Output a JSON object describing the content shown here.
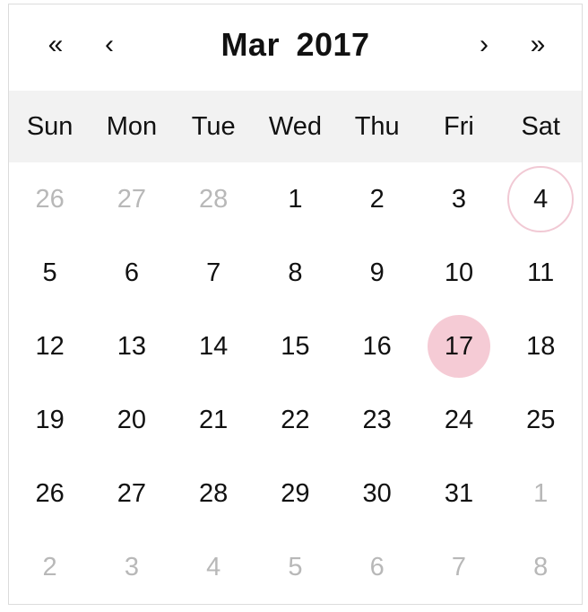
{
  "header": {
    "prev_year_label": "«",
    "prev_month_label": "‹",
    "title": "Mar 2017",
    "next_month_label": "›",
    "next_year_label": "»"
  },
  "weekdays": [
    "Sun",
    "Mon",
    "Tue",
    "Wed",
    "Thu",
    "Fri",
    "Sat"
  ],
  "days": [
    {
      "label": "26",
      "state": "other"
    },
    {
      "label": "27",
      "state": "other"
    },
    {
      "label": "28",
      "state": "other"
    },
    {
      "label": "1",
      "state": "current"
    },
    {
      "label": "2",
      "state": "current"
    },
    {
      "label": "3",
      "state": "current"
    },
    {
      "label": "4",
      "state": "today"
    },
    {
      "label": "5",
      "state": "current"
    },
    {
      "label": "6",
      "state": "current"
    },
    {
      "label": "7",
      "state": "current"
    },
    {
      "label": "8",
      "state": "current"
    },
    {
      "label": "9",
      "state": "current"
    },
    {
      "label": "10",
      "state": "current"
    },
    {
      "label": "11",
      "state": "current"
    },
    {
      "label": "12",
      "state": "current"
    },
    {
      "label": "13",
      "state": "current"
    },
    {
      "label": "14",
      "state": "current"
    },
    {
      "label": "15",
      "state": "current"
    },
    {
      "label": "16",
      "state": "current"
    },
    {
      "label": "17",
      "state": "selected"
    },
    {
      "label": "18",
      "state": "current"
    },
    {
      "label": "19",
      "state": "current"
    },
    {
      "label": "20",
      "state": "current"
    },
    {
      "label": "21",
      "state": "current"
    },
    {
      "label": "22",
      "state": "current"
    },
    {
      "label": "23",
      "state": "current"
    },
    {
      "label": "24",
      "state": "current"
    },
    {
      "label": "25",
      "state": "current"
    },
    {
      "label": "26",
      "state": "current"
    },
    {
      "label": "27",
      "state": "current"
    },
    {
      "label": "28",
      "state": "current"
    },
    {
      "label": "29",
      "state": "current"
    },
    {
      "label": "30",
      "state": "current"
    },
    {
      "label": "31",
      "state": "current"
    },
    {
      "label": "1",
      "state": "other"
    },
    {
      "label": "2",
      "state": "other"
    },
    {
      "label": "3",
      "state": "other"
    },
    {
      "label": "4",
      "state": "other"
    },
    {
      "label": "5",
      "state": "other"
    },
    {
      "label": "6",
      "state": "other"
    },
    {
      "label": "7",
      "state": "other"
    },
    {
      "label": "8",
      "state": "other"
    }
  ],
  "colors": {
    "selected_bg": "#f5cbd5",
    "today_ring": "#f1c9d4",
    "other_month_text": "#b8b8b8",
    "weekday_bg": "#f2f2f2"
  }
}
